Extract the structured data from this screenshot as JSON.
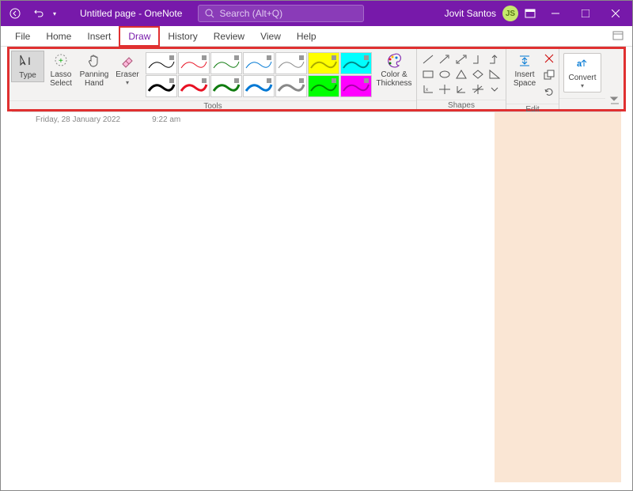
{
  "titlebar": {
    "title": "Untitled page  -  OneNote",
    "search_placeholder": "Search (Alt+Q)",
    "user_name": "Jovit Santos",
    "user_initials": "JS"
  },
  "menubar": {
    "items": [
      "File",
      "Home",
      "Insert",
      "Draw",
      "History",
      "Review",
      "View",
      "Help"
    ],
    "active": "Draw"
  },
  "ribbon": {
    "tools_label": "Tools",
    "shapes_label": "Shapes",
    "edit_label": "Edit",
    "type_btn": "Type",
    "lasso_btn": "Lasso Select",
    "panning_btn": "Panning Hand",
    "eraser_btn": "Eraser",
    "color_thickness": "Color & Thickness",
    "insert_space": "Insert Space",
    "convert": "Convert",
    "pen_colors_thin": [
      "#000000",
      "#e81123",
      "#107c10",
      "#0078d4",
      "#5c2d91",
      "#000000",
      "#000000"
    ],
    "pen_colors_thick": [
      "#000000",
      "#e81123",
      "#107c10",
      "#0078d4",
      "#5c2d91",
      "#000000",
      "#000000"
    ]
  },
  "page": {
    "date": "Friday, 28 January 2022",
    "time": "9:22 am"
  }
}
